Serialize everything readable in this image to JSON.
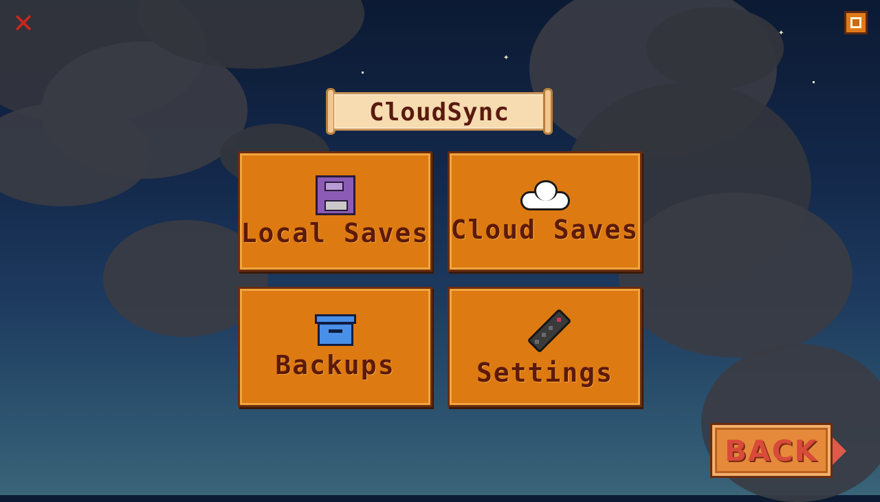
{
  "title": "CloudSync",
  "tiles": {
    "local": {
      "label": "Local Saves",
      "icon": "floppy-disk-icon"
    },
    "cloud": {
      "label": "Cloud Saves",
      "icon": "cloud-icon"
    },
    "backups": {
      "label": "Backups",
      "icon": "archive-box-icon"
    },
    "settings": {
      "label": "Settings",
      "icon": "remote-control-icon"
    }
  },
  "back_button": {
    "label": "BACK"
  },
  "colors": {
    "tile_bg": "#dd7a12",
    "tile_border": "#6b2c0e",
    "text_dark": "#5c1a0a",
    "back_text": "#d84a3a",
    "sky_top": "#0c1a33"
  }
}
